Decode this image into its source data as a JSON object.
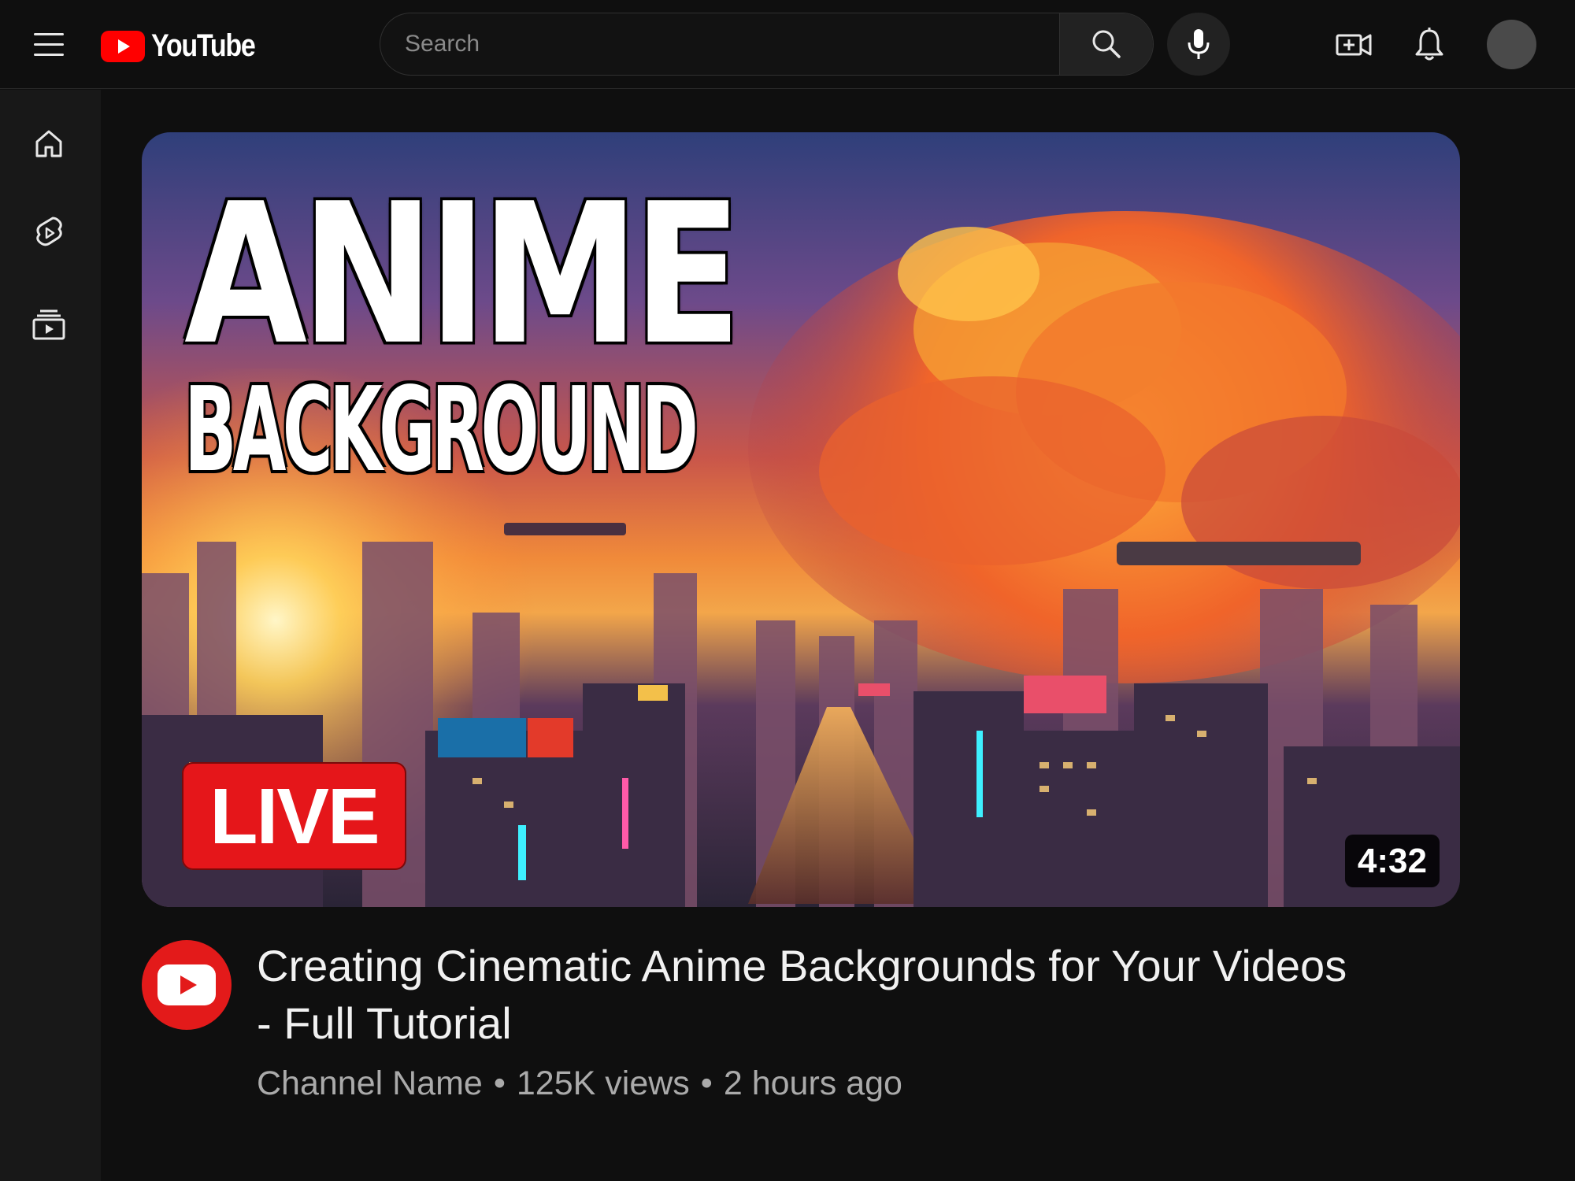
{
  "header": {
    "logo_text": "YouTube",
    "search": {
      "placeholder": "Search",
      "value": ""
    }
  },
  "icons": {
    "menu": "hamburger-icon",
    "search": "search-icon",
    "mic": "microphone-icon",
    "create": "create-video-icon",
    "notifications": "bell-icon",
    "home": "home-icon",
    "shorts": "shorts-icon",
    "subscriptions": "subscriptions-icon"
  },
  "video": {
    "thumbnail": {
      "title_line1": "ANIME",
      "title_line2": "BACKGROUND",
      "badge": "LIVE",
      "duration": "4:32"
    },
    "title": "Creating Cinematic Anime Backgrounds for Your Videos - Full Tutorial",
    "channel": "Channel Name",
    "views": "125K views",
    "age": "2 hours ago"
  },
  "colors": {
    "background": "#0f0f0f",
    "sidebar": "#181818",
    "brand_red": "#ff0000",
    "live_red": "#e5161a",
    "meta_text": "#aaaaaa"
  }
}
